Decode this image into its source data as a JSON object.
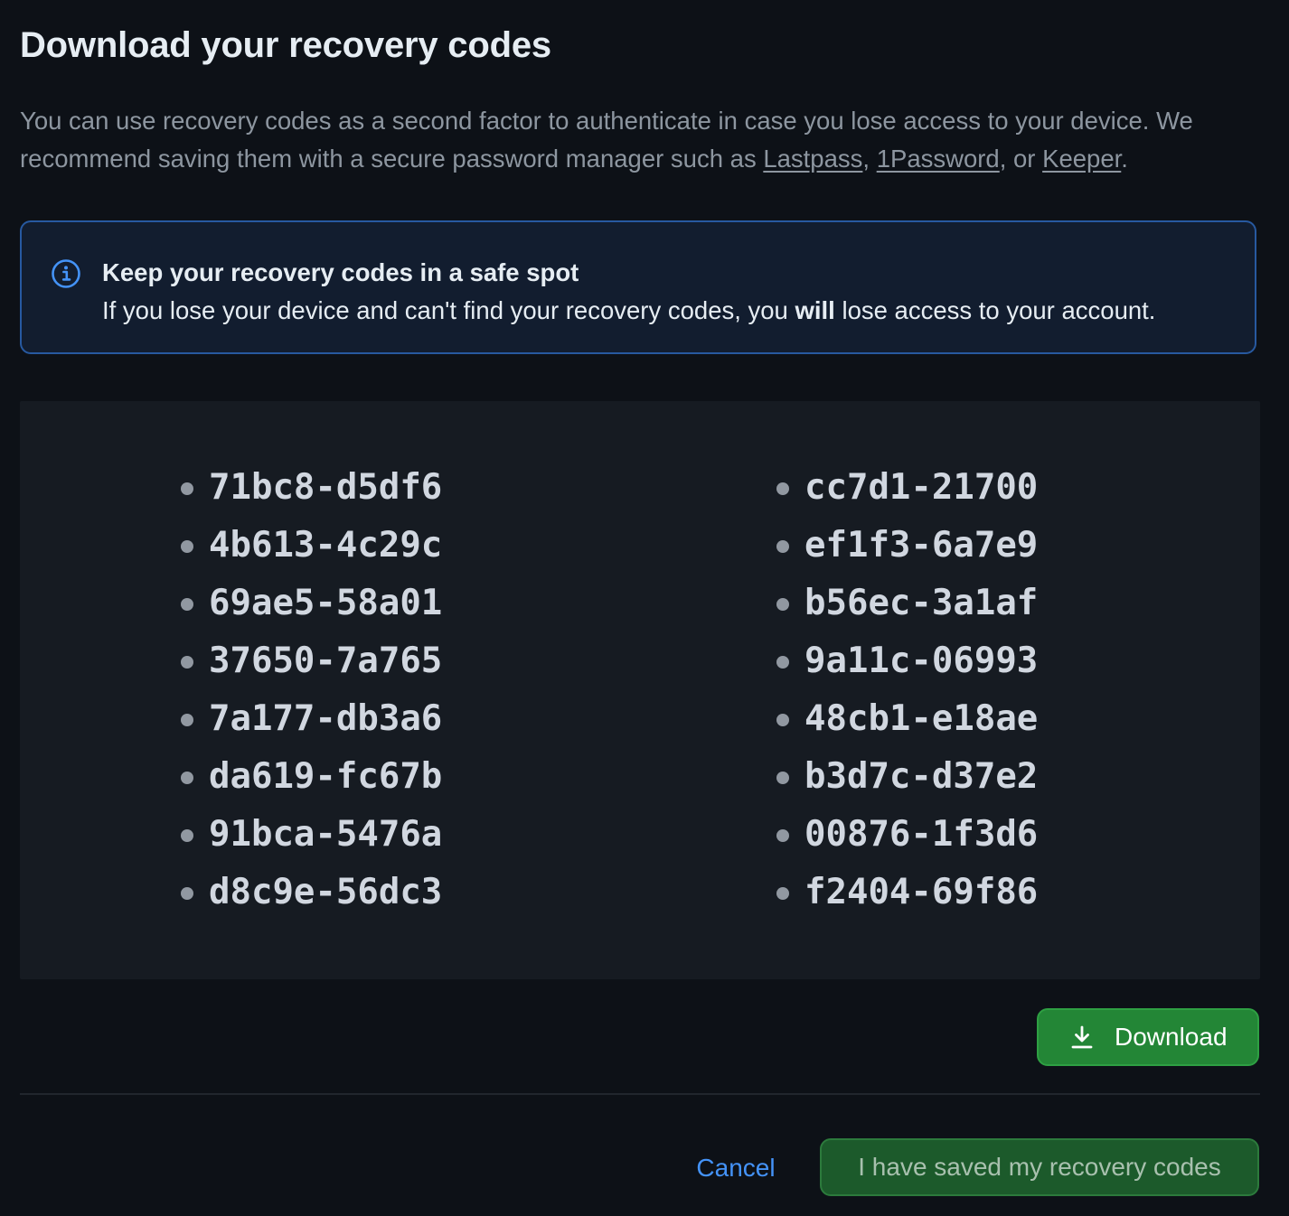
{
  "dialog": {
    "title": "Download your recovery codes",
    "intro": {
      "text_before": "You can use recovery codes as a second factor to authenticate in case you lose access to your device. We recommend saving them with a secure password manager such as ",
      "links": [
        "Lastpass",
        "1Password",
        "Keeper"
      ],
      "separator_1": ", ",
      "separator_2": ", or ",
      "text_after": "."
    },
    "flash": {
      "icon": "info-icon",
      "title": "Keep your recovery codes in a safe spot",
      "body_before": "If you lose your device and can't find your recovery codes, you ",
      "body_emphasis": "will",
      "body_after": " lose access to your account."
    },
    "codes": {
      "left": [
        "71bc8-d5df6",
        "4b613-4c29c",
        "69ae5-58a01",
        "37650-7a765",
        "7a177-db3a6",
        "da619-fc67b",
        "91bca-5476a",
        "d8c9e-56dc3"
      ],
      "right": [
        "cc7d1-21700",
        "ef1f3-6a7e9",
        "b56ec-3a1af",
        "9a11c-06993",
        "48cb1-e18ae",
        "b3d7c-d37e2",
        "00876-1f3d6",
        "f2404-69f86"
      ]
    },
    "download_button": {
      "label": "Download",
      "icon": "download-icon"
    },
    "footer": {
      "cancel_label": "Cancel",
      "confirm_label": "I have saved my recovery codes"
    }
  },
  "colors": {
    "background": "#0d1117",
    "codes_background": "#161b22",
    "flash_background": "#121d2f",
    "flash_border": "#1f6feb",
    "accent_link": "#4493f8",
    "primary_button": "#238636",
    "muted_text": "#8d96a0"
  }
}
